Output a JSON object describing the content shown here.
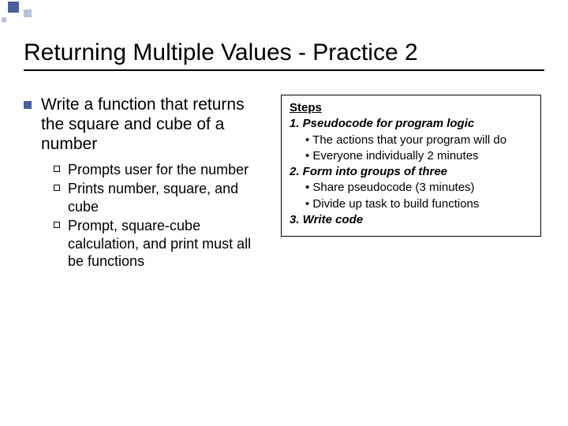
{
  "title": "Returning Multiple Values - Practice 2",
  "main": {
    "bullet": "Write a function that returns the square and cube of a number",
    "subs": [
      "Prompts user for the number",
      "Prints number, square, and cube",
      "Prompt, square-cube calculation, and print must all be functions"
    ]
  },
  "steps": {
    "heading": "Steps",
    "items": [
      {
        "label": "1. Pseudocode for program logic",
        "subs": [
          "The actions that your program will do",
          "Everyone individually 2 minutes"
        ]
      },
      {
        "label": "2. Form into groups of three",
        "subs": [
          "Share pseudocode (3 minutes)",
          "Divide up task to build functions"
        ]
      },
      {
        "label": "3. Write code",
        "subs": []
      }
    ]
  }
}
